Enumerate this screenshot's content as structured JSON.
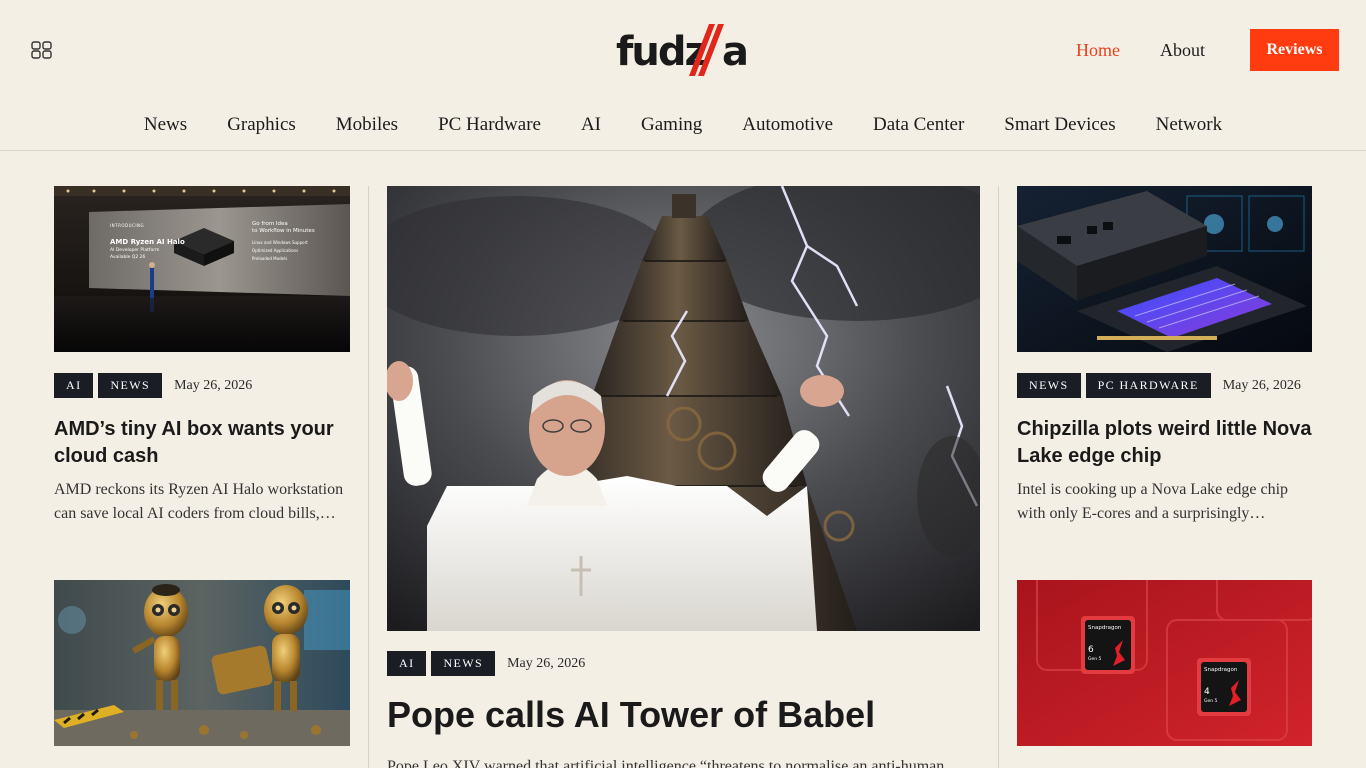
{
  "header": {
    "logo_text": "fudzilla",
    "links": {
      "home": "Home",
      "about": "About",
      "reviews": "Reviews"
    }
  },
  "nav": [
    "News",
    "Graphics",
    "Mobiles",
    "PC Hardware",
    "AI",
    "Gaming",
    "Automotive",
    "Data Center",
    "Smart Devices",
    "Network"
  ],
  "colors": {
    "accent": "#ff3b0f",
    "home_link": "#e8411f",
    "tag_bg": "#1b1d24",
    "page_bg": "#f4efe4"
  },
  "left": {
    "article1": {
      "tags": [
        "AI",
        "NEWS"
      ],
      "date": "May 26, 2026",
      "title": "AMD’s tiny AI box wants your cloud cash",
      "excerpt": "AMD reckons its Ryzen AI Halo workstation can save local AI coders from cloud bills,…",
      "image_text": {
        "intro": "INTRODUCING",
        "product": "AMD Ryzen AI Halo",
        "sub": "AI Developer Platform",
        "avail": "Available Q2 26",
        "slogan1": "Go from Idea",
        "slogan2": "to Workflow in Minutes",
        "b1": "Linux and Windows Support",
        "b2": "Optimized Applications",
        "b3": "Preloaded Models"
      }
    }
  },
  "center": {
    "tags": [
      "AI",
      "NEWS"
    ],
    "date": "May 26, 2026",
    "title": "Pope calls AI Tower of Babel",
    "excerpt": "Pope Leo XIV warned that artificial intelligence “threatens to normalise an anti-human"
  },
  "right": {
    "article1": {
      "tags": [
        "NEWS",
        "PC HARDWARE"
      ],
      "date": "May 26, 2026",
      "title": "Chipzilla plots weird little Nova Lake edge chip",
      "excerpt": "Intel is cooking up a Nova Lake edge chip with only E-cores and a surprisingly…"
    },
    "article2": {
      "image_text": {
        "brand": "Snapdragon",
        "chip1_num": "6",
        "chip1_gen": "Gen 5",
        "chip2_num": "4",
        "chip2_gen": "Gen 5"
      }
    }
  }
}
